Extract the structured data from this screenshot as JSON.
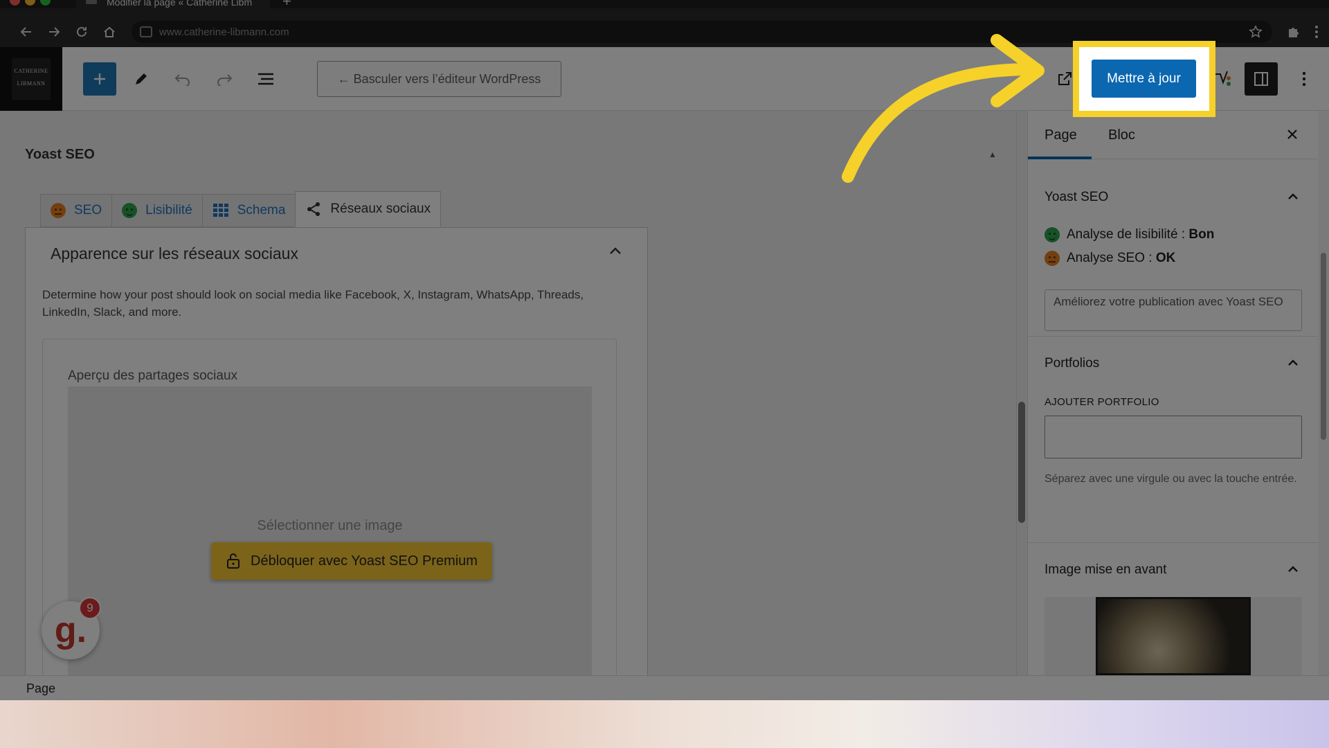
{
  "browser": {
    "tab_title": "Modifier la page « Catherine Libm",
    "url": "www.catherine-libmann.com"
  },
  "header": {
    "logo_text_line1": "CATHERINE",
    "logo_text_line2": "LIBMANN",
    "switch_editor_label": "← Basculer vers l’éditeur WordPress",
    "update_label": "Mettre à jour"
  },
  "yoast": {
    "title": "Yoast SEO",
    "tabs": [
      {
        "label": "SEO"
      },
      {
        "label": "Lisibilité"
      },
      {
        "label": "Schema"
      },
      {
        "label": "Réseaux sociaux"
      }
    ],
    "panel_title": "Apparence sur les réseaux sociaux",
    "panel_desc": "Determine how your post should look on social media like Facebook, X, Instagram, WhatsApp, Threads, LinkedIn, Slack, and more.",
    "preview_label": "Aperçu des partages sociaux",
    "select_image": "Sélectionner une image",
    "unlock_label": "Débloquer avec Yoast SEO Premium"
  },
  "badge": {
    "letter": "g.",
    "count": "9"
  },
  "sidebar": {
    "tabs": [
      {
        "label": "Page"
      },
      {
        "label": "Bloc"
      }
    ],
    "yoast_section": {
      "title": "Yoast SEO",
      "readability_label": "Analyse de lisibilité : ",
      "readability_value": "Bon",
      "seo_label": "Analyse SEO : ",
      "seo_value": "OK",
      "improve_label": "Améliorez votre publication avec Yoast SEO"
    },
    "portfolios": {
      "title": "Portfolios",
      "field_label": "AJOUTER PORTFOLIO",
      "help": "Séparez avec une virgule ou avec la touche entrée."
    },
    "featured": {
      "title": "Image mise en avant"
    }
  },
  "statusbar": {
    "label": "Page"
  },
  "colors": {
    "accent": "#0b67b0",
    "highlight": "#f5d12a",
    "good": "#2ea44f",
    "ok": "#e67e22"
  }
}
